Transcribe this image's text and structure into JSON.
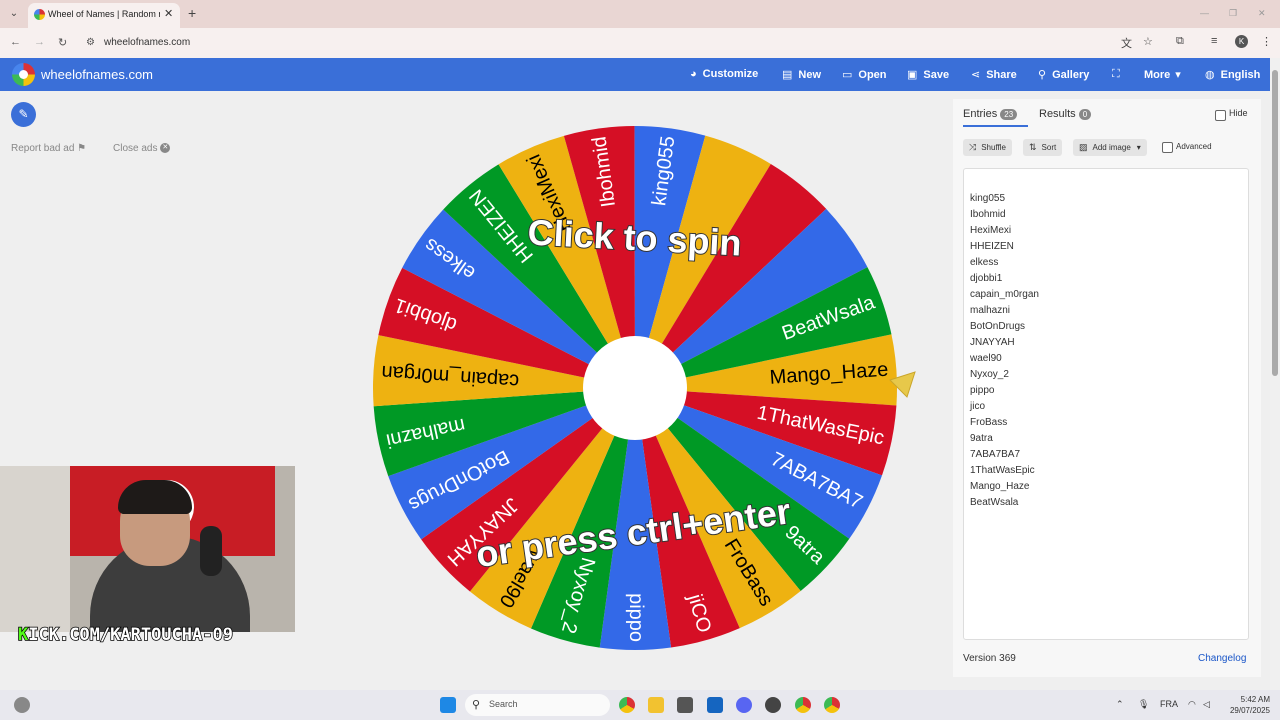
{
  "browser": {
    "tab_title": "Wheel of Names | Random name",
    "url": "wheelofnames.com",
    "profile_initial": "K"
  },
  "header": {
    "brand": "wheelofnames.com",
    "buttons": [
      {
        "label": "Customize",
        "icon": "palette-icon"
      },
      {
        "label": "New",
        "icon": "file-icon"
      },
      {
        "label": "Open",
        "icon": "folder-open-icon"
      },
      {
        "label": "Save",
        "icon": "save-icon"
      },
      {
        "label": "Share",
        "icon": "share-icon"
      },
      {
        "label": "Gallery",
        "icon": "search-icon"
      },
      {
        "label": "More",
        "icon": "chevron-down-icon"
      },
      {
        "label": "English",
        "icon": "globe-icon"
      }
    ]
  },
  "left": {
    "report_bad_ad": "Report bad ad",
    "close_ads": "Close ads",
    "stream_overlay_prefix": "K",
    "stream_overlay": "ICK.COM/KARTOUCHA-09"
  },
  "wheel": {
    "prompt_top": "Click to spin",
    "prompt_bottom": "or press ctrl+enter",
    "colors": [
      "#3369e8",
      "#d50f25",
      "#eeb211",
      "#009925"
    ],
    "slices": [
      {
        "label": "Mango_Haze",
        "color": "#eeb211"
      },
      {
        "label": "1ThatWasEpic",
        "color": "#d50f25"
      },
      {
        "label": "7ABA7BA7",
        "color": "#3369e8"
      },
      {
        "label": "9atra",
        "color": "#009925"
      },
      {
        "label": "FroBass",
        "color": "#eeb211"
      },
      {
        "label": "jiCO",
        "color": "#d50f25"
      },
      {
        "label": "pippo",
        "color": "#3369e8"
      },
      {
        "label": "Nyxoy_2",
        "color": "#009925"
      },
      {
        "label": "wael90",
        "color": "#eeb211"
      },
      {
        "label": "JNAYYAH",
        "color": "#d50f25"
      },
      {
        "label": "BotOnDrugs",
        "color": "#3369e8"
      },
      {
        "label": "malhazni",
        "color": "#009925"
      },
      {
        "label": "capain_m0rgan",
        "color": "#eeb211"
      },
      {
        "label": "djobbi1",
        "color": "#d50f25"
      },
      {
        "label": "elkess",
        "color": "#3369e8"
      },
      {
        "label": "HHEIZEN",
        "color": "#009925"
      },
      {
        "label": "HexiMexi",
        "color": "#eeb211"
      },
      {
        "label": "Ibohmid",
        "color": "#d50f25"
      },
      {
        "label": "king055",
        "color": "#3369e8"
      },
      {
        "label": "",
        "color": "#eeb211"
      },
      {
        "label": "",
        "color": "#d50f25"
      },
      {
        "label": "",
        "color": "#3369e8"
      },
      {
        "label": "BeatWsala",
        "color": "#009925"
      }
    ]
  },
  "panel": {
    "tab_entries": "Entries",
    "entries_count": "23",
    "tab_results": "Results",
    "results_count": "0",
    "hide": "Hide",
    "shuffle": "Shuffle",
    "sort": "Sort",
    "add_image": "Add image",
    "advanced": "Advanced",
    "entries": [
      "",
      "king055",
      "Ibohmid",
      "HexiMexi",
      "HHEIZEN",
      "elkess",
      "djobbi1",
      "capain_m0rgan",
      "malhazni",
      "BotOnDrugs",
      "JNAYYAH",
      "wael90",
      "Nyxoy_2",
      "pippo",
      "jico",
      "FroBass",
      "9atra",
      "7ABA7BA7",
      "1ThatWasEpic",
      "Mango_Haze",
      "BeatWsala"
    ],
    "version": "Version 369",
    "changelog": "Changelog"
  },
  "taskbar": {
    "search": "Search",
    "lang": "FRA",
    "time": "5:42 AM",
    "date": "29/07/2025"
  }
}
